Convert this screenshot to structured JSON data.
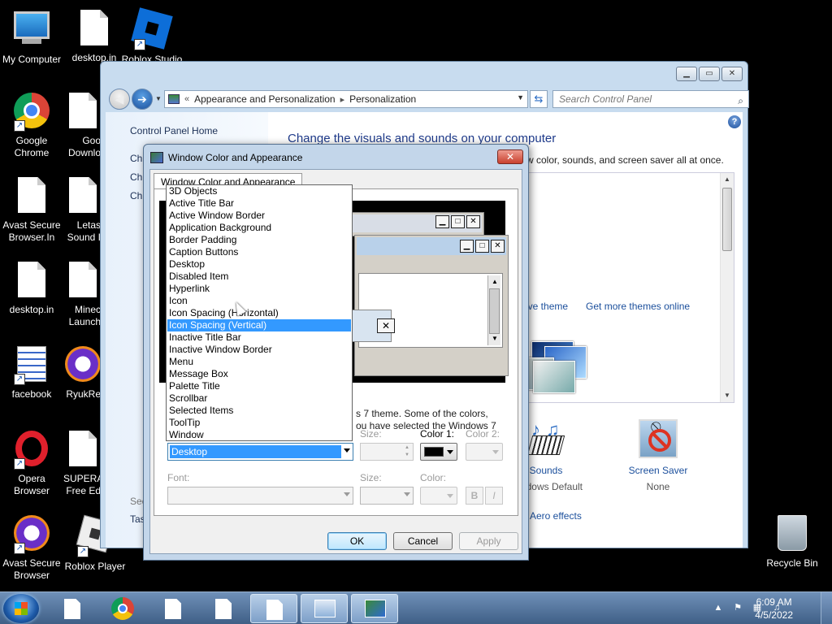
{
  "desktop": {
    "icons": [
      {
        "label": "My Computer",
        "icon": "computer-icon"
      },
      {
        "label": "desktop.in",
        "icon": "file-icon"
      },
      {
        "label": "Roblox Studio",
        "icon": "roblox-studio-icon"
      },
      {
        "label": "Google Chrome",
        "icon": "chrome-icon"
      },
      {
        "label": "Goo Downlo",
        "icon": "file-icon"
      },
      {
        "label": "Avast Secure Browser.In",
        "icon": "file-icon"
      },
      {
        "label": "Letas Sound I",
        "icon": "file-icon"
      },
      {
        "label": "desktop.in",
        "icon": "file-icon"
      },
      {
        "label": "Minec Launch",
        "icon": "file-icon"
      },
      {
        "label": "facebook",
        "icon": "facebook-icon"
      },
      {
        "label": "RyukRe",
        "icon": "avast-icon"
      },
      {
        "label": "Opera Browser",
        "icon": "opera-icon"
      },
      {
        "label": "SUPERA Free Ed",
        "icon": "file-icon"
      },
      {
        "label": "Avast Secure Browser",
        "icon": "avast-icon"
      },
      {
        "label": "Roblox Player",
        "icon": "roblox-player-icon"
      },
      {
        "label": "Recycle Bin",
        "icon": "recycle-bin-icon"
      }
    ]
  },
  "control_panel": {
    "breadcrumb": {
      "root": "«",
      "part1": "Appearance and Personalization",
      "sep": "▸",
      "part2": "Personalization"
    },
    "search_placeholder": "Search Control Panel",
    "left": {
      "home": "Control Panel Home",
      "links": [
        "Ch",
        "Ch",
        "Ch"
      ],
      "see_also": "See",
      "tas": "Tas"
    },
    "title": "Change the visuals and sounds on your computer",
    "description": "w color, sounds, and screen saver all at once.",
    "theme_links": {
      "save": "Save theme",
      "more": "Get more themes online"
    },
    "bottom": {
      "sounds_label": "Sounds",
      "sounds_sub": "Windows Default",
      "saver_label": "Screen Saver",
      "saver_sub": "None"
    },
    "aero_link": "Aero effects"
  },
  "dialog": {
    "title": "Window Color and Appearance",
    "close": "✕",
    "tab": "Window Color and Appearance",
    "info_line1": "s 7 theme.  Some of the colors,",
    "info_line2": "ou have selected the Windows 7",
    "item_label": "Item:",
    "item_value": "Desktop",
    "size_label": "Size:",
    "color1_label": "Color 1:",
    "color2_label": "Color 2:",
    "font_label": "Font:",
    "font_size_label": "Size:",
    "font_color_label": "Color:",
    "bold": "B",
    "italic": "I",
    "ok": "OK",
    "cancel": "Cancel",
    "apply": "Apply",
    "color1_value": "#000000"
  },
  "dropdown": {
    "items": [
      "3D Objects",
      "Active Title Bar",
      "Active Window Border",
      "Application Background",
      "Border Padding",
      "Caption Buttons",
      "Desktop",
      "Disabled Item",
      "Hyperlink",
      "Icon",
      "Icon Spacing (Horizontal)",
      "Icon Spacing (Vertical)",
      "Inactive Title Bar",
      "Inactive Window Border",
      "Menu",
      "Message Box",
      "Palette Title",
      "Scrollbar",
      "Selected Items",
      "ToolTip",
      "Window"
    ],
    "selected": "Icon Spacing (Vertical)"
  },
  "taskbar": {
    "time": "6:09 AM",
    "date": "4/5/2022",
    "tray_chevron": "▲"
  },
  "colors": {
    "selection": "#3399ff",
    "link": "#1b4f9c",
    "title": "#1e3a8a"
  }
}
